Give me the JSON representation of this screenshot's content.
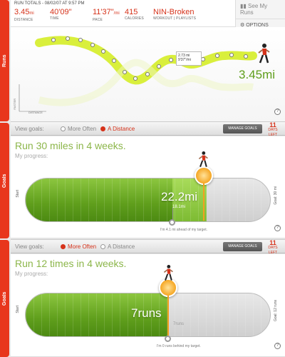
{
  "tabs": {
    "runs": "Runs",
    "goals": "Goals"
  },
  "stats": {
    "header": "Run Totals - 08/02/07 at 9:57 PM",
    "distance_value": "3.45",
    "distance_unit": "mi",
    "distance_label": "Distance",
    "time_value": "40'09\"",
    "time_label": "Time",
    "pace_value": "11'37\"",
    "pace_unit": "/mi",
    "pace_label": "Pace",
    "calories_value": "415",
    "calories_label": "Calories",
    "playlist_value": "NIN-Broken",
    "workout_label": "Workout",
    "playlists_label": "Playlists"
  },
  "menu": {
    "see_my_runs": "See My Runs",
    "options": "Options"
  },
  "graph": {
    "total_distance": "3.45mi",
    "tooltip_distance": "2.73 mi",
    "tooltip_pace": "9'37\"/mi",
    "y_label": "Faster",
    "x_label": "Distance",
    "help": "?"
  },
  "goals_bar_1": {
    "view_goals": "View goals:",
    "opt1": "More Often",
    "opt2": "A Distance",
    "active": 2,
    "manage": "Manage Goals",
    "days": "11",
    "days_label": "Days Left"
  },
  "goal1": {
    "title": "Run 30 miles in 4 weeks.",
    "subtitle": "My progress:",
    "start": "Start",
    "goal": "Goal: 30 mi",
    "value": "22.2mi",
    "target": "18.1mi",
    "note": "I'm 4.1 mi ahead of my target.",
    "progress": 0.74,
    "target_fraction": 0.6
  },
  "goals_bar_2": {
    "view_goals": "View goals:",
    "opt1": "More Often",
    "opt2": "A Distance",
    "active": 1,
    "manage": "Manage Goals",
    "days": "11",
    "days_label": "Days Left"
  },
  "goal2": {
    "title": "Run 12 times in 4 weeks.",
    "subtitle": "My progress:",
    "start": "Start",
    "goal": "Goal: 12 runs",
    "value": "7runs",
    "target": "7runs",
    "note": "I'm 0 runs behind my target.",
    "progress": 0.58,
    "target_fraction": 0.58
  },
  "colors": {
    "accent": "#d6321a",
    "green": "#8cb64a",
    "graph_line": "#d9ef3c"
  }
}
